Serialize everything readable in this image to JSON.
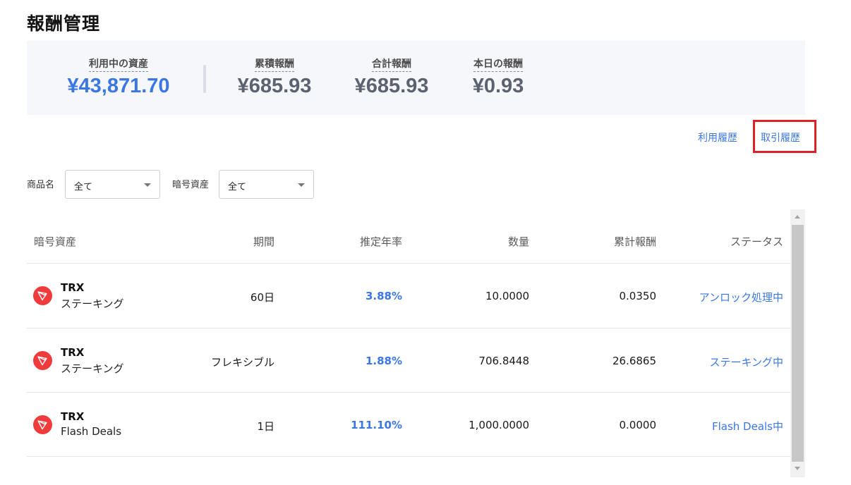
{
  "page": {
    "title": "報酬管理"
  },
  "summary": {
    "active_assets": {
      "label": "利用中の資産",
      "value": "¥43,871.70"
    },
    "cumulative_reward": {
      "label": "累積報酬",
      "value": "¥685.93"
    },
    "total_reward": {
      "label": "合計報酬",
      "value": "¥685.93"
    },
    "today_reward": {
      "label": "本日の報酬",
      "value": "¥0.93"
    }
  },
  "links": {
    "usage_history": "利用履歴",
    "trade_history": "取引履歴"
  },
  "filters": {
    "product": {
      "label": "商品名",
      "value": "全て"
    },
    "asset": {
      "label": "暗号資産",
      "value": "全て"
    }
  },
  "table": {
    "headers": {
      "asset": "暗号資産",
      "period": "期間",
      "rate": "推定年率",
      "quantity": "数量",
      "reward": "累計報酬",
      "status": "ステータス"
    },
    "rows": [
      {
        "coin": "TRX",
        "product": "ステーキング",
        "period": "60日",
        "rate": "3.88%",
        "quantity": "10.0000",
        "reward": "0.0350",
        "status": "アンロック処理中"
      },
      {
        "coin": "TRX",
        "product": "ステーキング",
        "period": "フレキシブル",
        "rate": "1.88%",
        "quantity": "706.8448",
        "reward": "26.6865",
        "status": "ステーキング中"
      },
      {
        "coin": "TRX",
        "product": "Flash Deals",
        "period": "1日",
        "rate": "111.10%",
        "quantity": "1,000.0000",
        "reward": "0.0000",
        "status": "Flash Deals中"
      }
    ]
  },
  "colors": {
    "accent": "#3b77e3",
    "highlight": "#e01f26",
    "trx": "#ef3b3b"
  },
  "icons": {
    "coin": "tron-icon",
    "dropdown": "caret-down-icon"
  }
}
